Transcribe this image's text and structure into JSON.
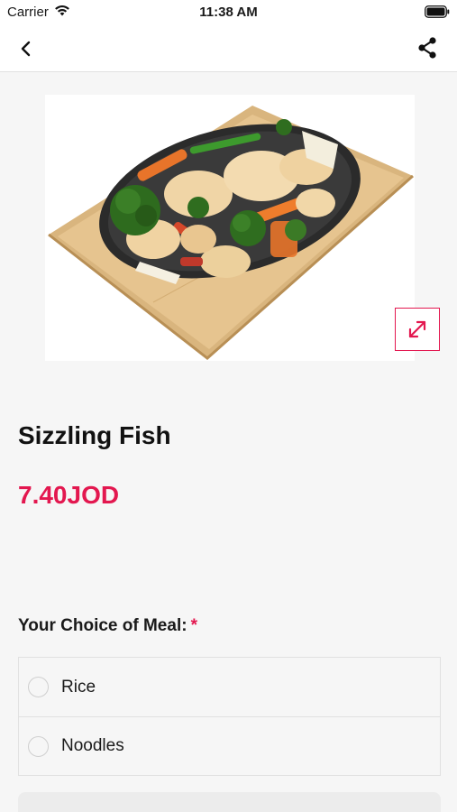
{
  "status_bar": {
    "carrier": "Carrier",
    "time": "11:38 AM",
    "wifi_icon": "wifi-icon",
    "battery_icon": "battery-icon"
  },
  "nav": {
    "back_icon": "chevron-left-icon",
    "share_icon": "share-icon"
  },
  "product": {
    "image_alt": "sizzling-platter-image",
    "expand_icon": "expand-icon",
    "title": "Sizzling Fish",
    "price": "7.40JOD"
  },
  "choice": {
    "label": "Your Choice of Meal:",
    "required_mark": "*",
    "options": [
      {
        "label": "Rice",
        "selected": false
      },
      {
        "label": "Noodles",
        "selected": false
      }
    ]
  },
  "colors": {
    "accent": "#e3174f",
    "background": "#f6f6f6",
    "surface": "#ffffff"
  }
}
